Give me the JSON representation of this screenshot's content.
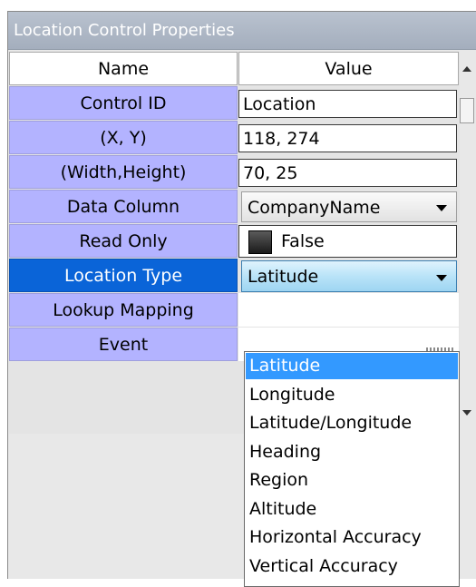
{
  "panel": {
    "title": "Location Control Properties"
  },
  "grid": {
    "headers": {
      "name": "Name",
      "value": "Value"
    },
    "rows": [
      {
        "name": "Control ID",
        "value": "Location"
      },
      {
        "name": "(X, Y)",
        "value": "118, 274"
      },
      {
        "name": "(Width,Height)",
        "value": "70, 25"
      },
      {
        "name": "Data Column",
        "value": "CompanyName"
      },
      {
        "name": "Read Only",
        "value": "False"
      },
      {
        "name": "Location Type",
        "value": "Latitude"
      },
      {
        "name": "Lookup Mapping",
        "value": ""
      },
      {
        "name": "Event",
        "value": ""
      }
    ]
  },
  "dropdown": {
    "options": [
      "Latitude",
      "Longitude",
      "Latitude/Longitude",
      "Heading",
      "Region",
      "Altitude",
      "Horizontal Accuracy",
      "Vertical Accuracy"
    ],
    "selected": "Latitude"
  },
  "colors": {
    "name_cell": "#b3b3ff",
    "selected_name_cell": "#0a64d8",
    "highlight_option": "#3399ff",
    "title_bar": "#a4aebd"
  },
  "icons": {
    "dropdown_arrow": "chevron-down-icon",
    "checkbox": "checkbox-icon"
  }
}
